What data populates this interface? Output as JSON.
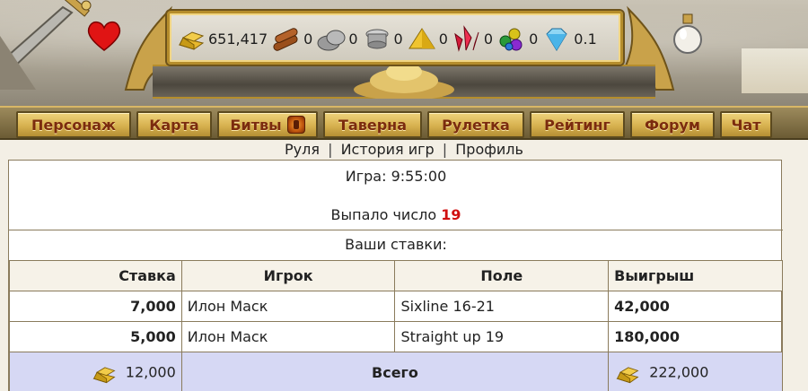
{
  "resources": [
    {
      "icon": "gold-bars-icon",
      "value": "651,417"
    },
    {
      "icon": "wood-logs-icon",
      "value": "0"
    },
    {
      "icon": "stone-icon",
      "value": "0"
    },
    {
      "icon": "iron-icon",
      "value": "0"
    },
    {
      "icon": "sulfur-icon",
      "value": "0"
    },
    {
      "icon": "crystals-icon",
      "value": "0"
    },
    {
      "icon": "gems-icon",
      "value": "0"
    },
    {
      "icon": "diamond-icon",
      "value": "0.1"
    }
  ],
  "nav": {
    "items": [
      "Персонаж",
      "Карта",
      "Битвы",
      "Таверна",
      "Рулетка",
      "Рейтинг",
      "Форум",
      "Чат"
    ]
  },
  "sublinks": {
    "roulette": "Руля",
    "history": "История игр",
    "profile": "Профиль",
    "separator": "|"
  },
  "game": {
    "label": "Игра: 9:55:00",
    "result_label": "Выпало число",
    "result_number": "19"
  },
  "bets": {
    "title": "Ваши ставки:",
    "headers": [
      "Ставка",
      "Игрок",
      "Поле",
      "Выигрыш"
    ],
    "rows": [
      {
        "bet": "7,000",
        "player": "Илон Маск",
        "field": "Sixline 16-21",
        "win": "42,000"
      },
      {
        "bet": "5,000",
        "player": "Илон Маск",
        "field": "Straight up 19",
        "win": "180,000"
      }
    ],
    "total": {
      "bet": "12,000",
      "label": "Всего",
      "win": "222,000"
    }
  },
  "colors": {
    "nav_text": "#7b2b0e",
    "nav_button": "#d7b14f",
    "result_number": "#d01010",
    "total_row": "#d6d8f4"
  }
}
